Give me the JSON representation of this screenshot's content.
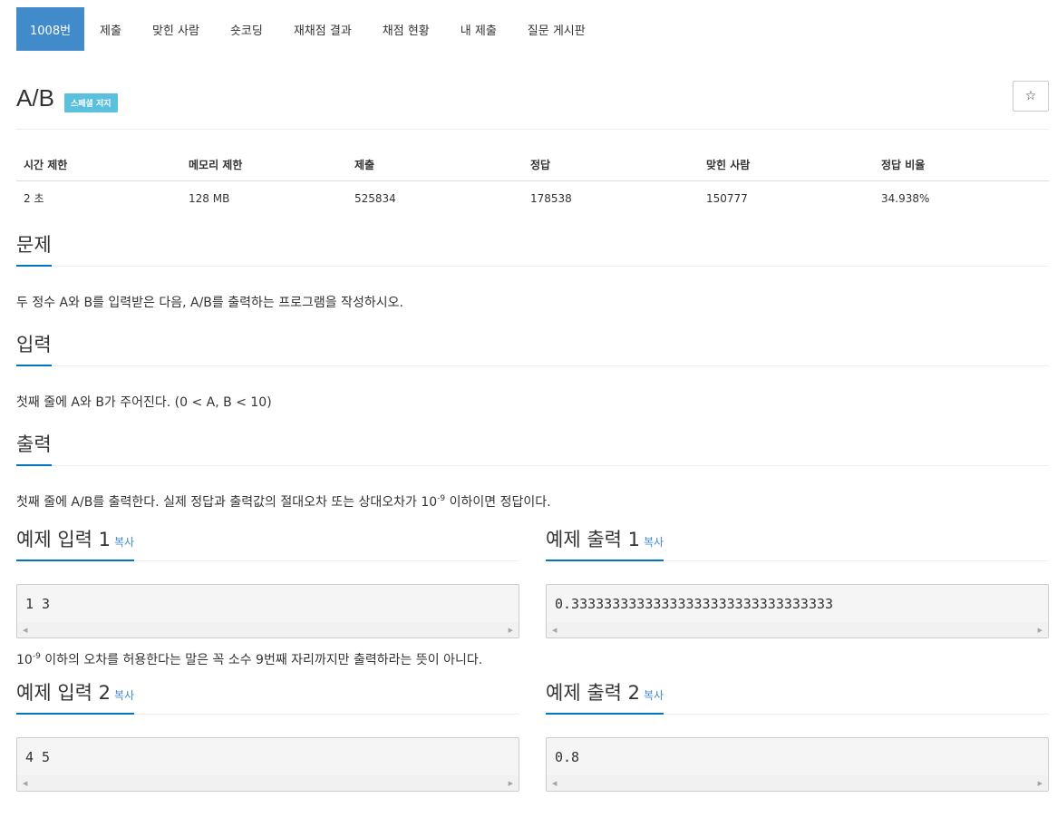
{
  "tabs": [
    {
      "label": "1008번"
    },
    {
      "label": "제출"
    },
    {
      "label": "맞힌 사람"
    },
    {
      "label": "숏코딩"
    },
    {
      "label": "재채점 결과"
    },
    {
      "label": "채점 현황"
    },
    {
      "label": "내 제출"
    },
    {
      "label": "질문 게시판"
    }
  ],
  "problem": {
    "title": "A/B",
    "badge": "스페셜 저지",
    "star": "☆"
  },
  "stats": {
    "headers": [
      "시간 제한",
      "메모리 제한",
      "제출",
      "정답",
      "맞힌 사람",
      "정답 비율"
    ],
    "values": [
      "2 초",
      "128 MB",
      "525834",
      "178538",
      "150777",
      "34.938%"
    ]
  },
  "sections": {
    "problem_h": "문제",
    "problem_text": "두 정수 A와 B를 입력받은 다음, A/B를 출력하는 프로그램을 작성하시오.",
    "input_h": "입력",
    "input_text": "첫째 줄에 A와 B가 주어진다. (0 < A, B < 10)",
    "output_h": "출력",
    "output_text_pre": "첫째 줄에 A/B를 출력한다. 실제 정답과 출력값의 절대오차 또는 상대오차가 10",
    "output_text_sup": "-9",
    "output_text_post": " 이하이면 정답이다."
  },
  "samples": {
    "copy_label": "복사",
    "input1_h": "예제 입력 1",
    "input1": "1 3",
    "output1_h": "예제 출력 1",
    "output1": "0.33333333333333333333333333333333",
    "note_pre": "10",
    "note_sup": "-9",
    "note_post": " 이하의 오차를 허용한다는 말은 꼭 소수 9번째 자리까지만 출력하라는 뜻이 아니다.",
    "input2_h": "예제 입력 2",
    "input2": "4 5",
    "output2_h": "예제 출력 2",
    "output2": "0.8"
  },
  "colors": {
    "tab_active": "#428bca",
    "badge": "#5bc0de",
    "accent_line": "#0076c0",
    "copy_link": "#428bca"
  }
}
